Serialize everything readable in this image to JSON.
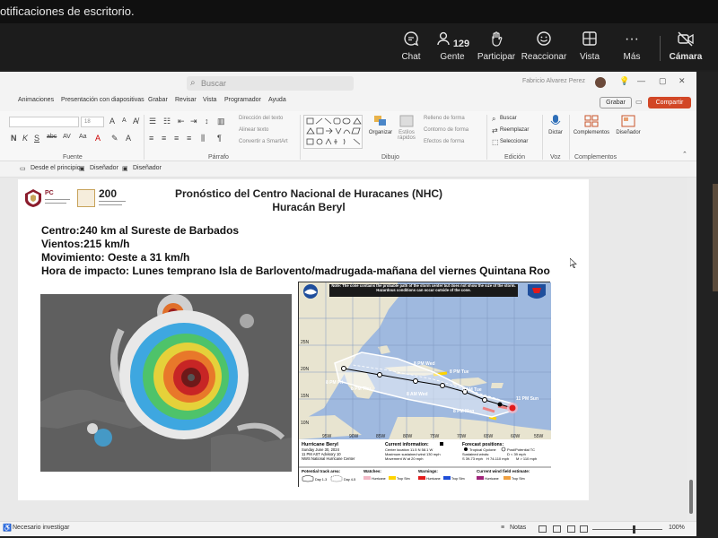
{
  "notification": {
    "text": "otificaciones de escritorio."
  },
  "meeting_toolbar": {
    "chat": "Chat",
    "people": "Gente",
    "people_count": "129",
    "raise_hand": "Participar",
    "react": "Reaccionar",
    "view": "Vista",
    "more": "Más",
    "more_icon": "···",
    "camera": "Cámara"
  },
  "ppt": {
    "search_placeholder": "Buscar",
    "user_name": "Fabricio Alvarez Perez",
    "menu": [
      "Animaciones",
      "Presentación con diapositivas",
      "Grabar",
      "Revisar",
      "Vista",
      "Programador",
      "Ayuda"
    ],
    "grabar_btn": "Grabar",
    "share_btn": "Compartir",
    "ribbon": {
      "font_size": "18",
      "font_bold": "N",
      "font_italic": "K",
      "font_underline": "S",
      "font_strike": "abc",
      "font_spacing": "AV",
      "font_case": "Aa",
      "text_direction": "Dirección del texto",
      "align_text": "Alinear texto",
      "smartart": "Convertir a SmartArt",
      "fill": "Relleno de forma",
      "outline": "Contorno de forma",
      "effects": "Efectos de forma",
      "organize": "Organizar",
      "quick_styles": "Estilos rápidos",
      "search": "Buscar",
      "replace": "Reemplazar",
      "select": "Seleccionar",
      "dictate": "Dictar",
      "addins": "Complementos",
      "designer": "Diseñador",
      "groups": [
        "Fuente",
        "Párrafo",
        "Dibujo",
        "Edición",
        "Voz",
        "Complementos"
      ]
    },
    "sub_bar": [
      "Desde el principio",
      "Diseñador",
      "Diseñador"
    ],
    "status_left": "Necesario investigar",
    "status_notes": "Notas",
    "zoom": "100%"
  },
  "slide": {
    "pc_text": "PC",
    "logo_text": "200",
    "title1": "Pronóstico del Centro Nacional de Huracanes (NHC)",
    "title2": "Huracán Beryl",
    "centro": "Centro:240 km al Sureste de Barbados",
    "vientos": "Vientos:215 km/h",
    "movimiento": "Movimiento: Oeste a 31 km/h",
    "hora": "Hora de impacto: Lunes temprano Isla de Barlovento/madrugada-mañana del viernes Quintana Roo"
  },
  "map": {
    "note": "Note: The cone contains the probable path of the storm center but does not show the size of the storm. Hazardous conditions can occur outside of the cone.",
    "lat_labels": [
      "25N",
      "20N",
      "15N",
      "10N"
    ],
    "lon_labels": [
      "95W",
      "90W",
      "85W",
      "80W",
      "75W",
      "70W",
      "65W",
      "60W",
      "55W"
    ],
    "points": [
      "11 PM Sun",
      "8 PM Mon",
      "8 AM Tue",
      "8 PM Tue",
      "8 AM Wed",
      "8 PM Wed",
      "8 PM Thu",
      "8 PM Fri"
    ],
    "storm_name": "Hurricane Beryl",
    "storm_date": "Sunday June 30, 2024",
    "storm_advisory": "11 PM AST Advisory 10",
    "storm_center": "NWS National Hurricane Center",
    "current_info_title": "Current information:",
    "current_info_lines": [
      "Center location 11.5 N 58.1 W",
      "Maximum sustained wind 130 mph",
      "Movement W at 20 mph"
    ],
    "forecast_title": "Forecast positions:",
    "forecast_lines": [
      "Tropical Cyclone",
      "Post/Potential TC",
      "Sustained winds:",
      "D < 39 mph",
      "S 39-73 mph",
      "H 74-110 mph",
      "M > 110 mph"
    ],
    "track_title": "Potential track area:",
    "track_day13": "Day 1-3",
    "track_day45": "Day 4-5",
    "watches_title": "Watches:",
    "warnings_title": "Warnings:",
    "wind_title": "Current wind field estimate:",
    "legend_hurricane": "Hurricane",
    "legend_trop": "Trop Stm"
  }
}
